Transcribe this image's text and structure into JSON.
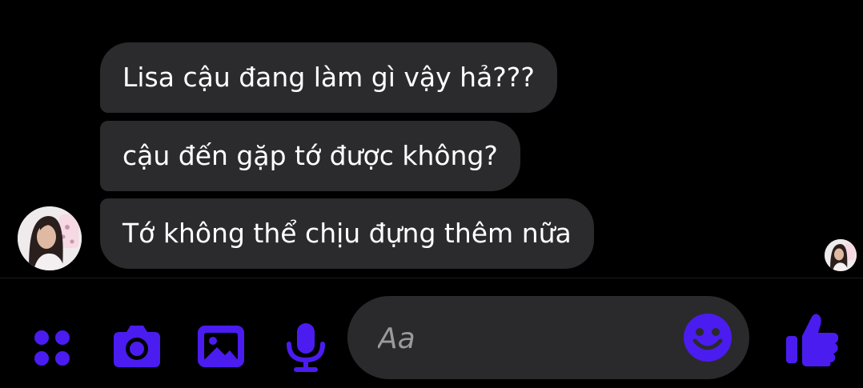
{
  "conversation": {
    "messages": [
      {
        "text": "Lisa cậu đang làm gì vậy hả???"
      },
      {
        "text": "cậu đến gặp tớ được không?"
      },
      {
        "text": "Tớ không thể chịu đựng thêm nữa"
      }
    ]
  },
  "composer": {
    "placeholder": "Aa",
    "value": ""
  },
  "icons": {
    "menu": "four-dots-icon",
    "camera": "camera-icon",
    "gallery": "image-icon",
    "voice": "microphone-icon",
    "emoji": "smiley-icon",
    "like": "thumbs-up-icon"
  },
  "colors": {
    "accent": "#4b1cf0",
    "bubble": "#2b2b2d",
    "input": "#2a2a2c",
    "background": "#000000"
  }
}
